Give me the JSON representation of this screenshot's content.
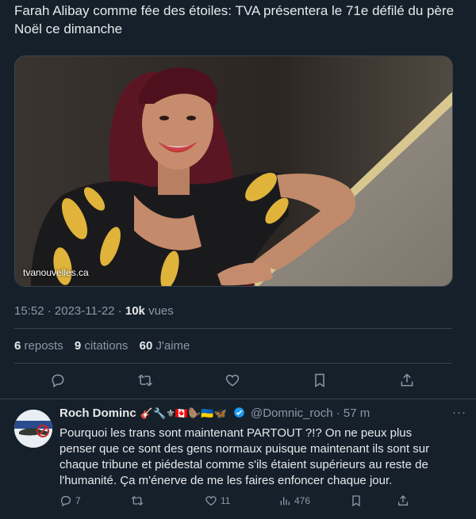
{
  "post": {
    "text": "Farah Alibay comme fée des étoiles: TVA présentera le 71e défilé du père Noël ce dimanche",
    "media_domain": "tvanouvelles.ca",
    "time": "15:52",
    "date": "2023-11-22",
    "views_count": "10k",
    "views_label": "vues",
    "reposts_count": "6",
    "reposts_label": "reposts",
    "quotes_count": "9",
    "quotes_label": "citations",
    "likes_count": "60",
    "likes_label": "J'aime"
  },
  "reply": {
    "name": "Roch Dominc",
    "emojis": "🎸🔧⚜🇨🇦🦫🇺🇦🦋",
    "handle": "@Domnic_roch",
    "time": "57 m",
    "text": "Pourquoi les trans sont maintenant PARTOUT ?!? On ne peux plus penser que ce sont des gens normaux puisque maintenant ils sont sur chaque tribune et piédestal comme s'ils étaient supérieurs au reste de l'humanité. Ça m'énerve de me les faires enfoncer chaque jour.",
    "replies": "7",
    "likes": "11",
    "views": "476"
  },
  "colors": {
    "background": "#15202b",
    "text": "#e7e9ea",
    "secondary": "#8b98a5",
    "border": "#38444d",
    "verified": "#1d9bf0"
  }
}
